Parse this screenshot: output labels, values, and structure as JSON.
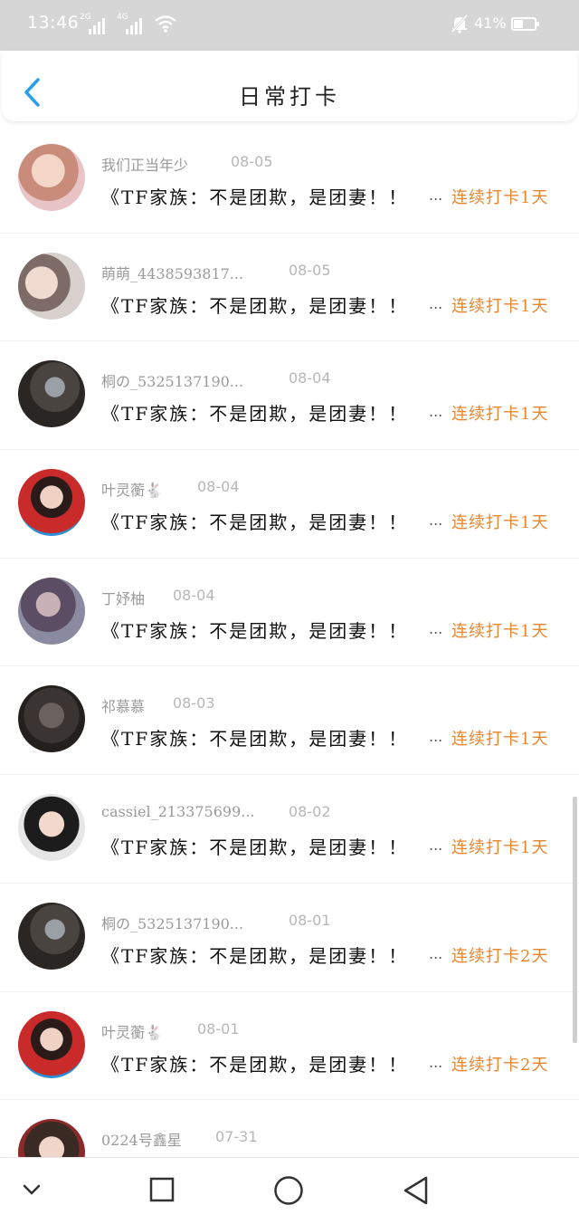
{
  "status_bar": {
    "time": "13:46",
    "signal1_tag": "2G",
    "signal2_tag": "4G",
    "battery": "41%"
  },
  "header": {
    "title": "日常打卡",
    "back_icon": "chevron-left-icon"
  },
  "colors": {
    "accent": "#2aa0e8",
    "streak": "#e8862e"
  },
  "entries": [
    {
      "name": "我们正当年少",
      "date": "08-05",
      "content": "《TF家族：不是团欺，是团妻！！",
      "streak": "连续打卡1天"
    },
    {
      "name": "萌萌_4438593817...",
      "date": "08-05",
      "content": "《TF家族：不是团欺，是团妻！！",
      "streak": "连续打卡1天"
    },
    {
      "name": "桐の_5325137190...",
      "date": "08-04",
      "content": "《TF家族：不是团欺，是团妻！！",
      "streak": "连续打卡1天"
    },
    {
      "name": "叶灵蘅🐇",
      "date": "08-04",
      "content": "《TF家族：不是团欺，是团妻！！",
      "streak": "连续打卡1天"
    },
    {
      "name": "丁妤柚",
      "date": "08-04",
      "content": "《TF家族：不是团欺，是团妻！！",
      "streak": "连续打卡1天"
    },
    {
      "name": "祁慕慕",
      "date": "08-03",
      "content": "《TF家族：不是团欺，是团妻！！",
      "streak": "连续打卡1天"
    },
    {
      "name": "cassiel_213375699...",
      "date": "08-02",
      "content": "《TF家族：不是团欺，是团妻！！",
      "streak": "连续打卡1天"
    },
    {
      "name": "桐の_5325137190...",
      "date": "08-01",
      "content": "《TF家族：不是团欺，是团妻！！",
      "streak": "连续打卡2天"
    },
    {
      "name": "叶灵蘅🐇",
      "date": "08-01",
      "content": "《TF家族：不是团欺，是团妻！！",
      "streak": "连续打卡2天"
    },
    {
      "name": "0224号鑫星",
      "date": "07-31",
      "content": "",
      "streak": ""
    }
  ],
  "ellipsis": "...",
  "nav": {
    "icons": [
      "chevron-down-icon",
      "recent-apps-icon",
      "home-icon",
      "back-triangle-icon"
    ]
  }
}
